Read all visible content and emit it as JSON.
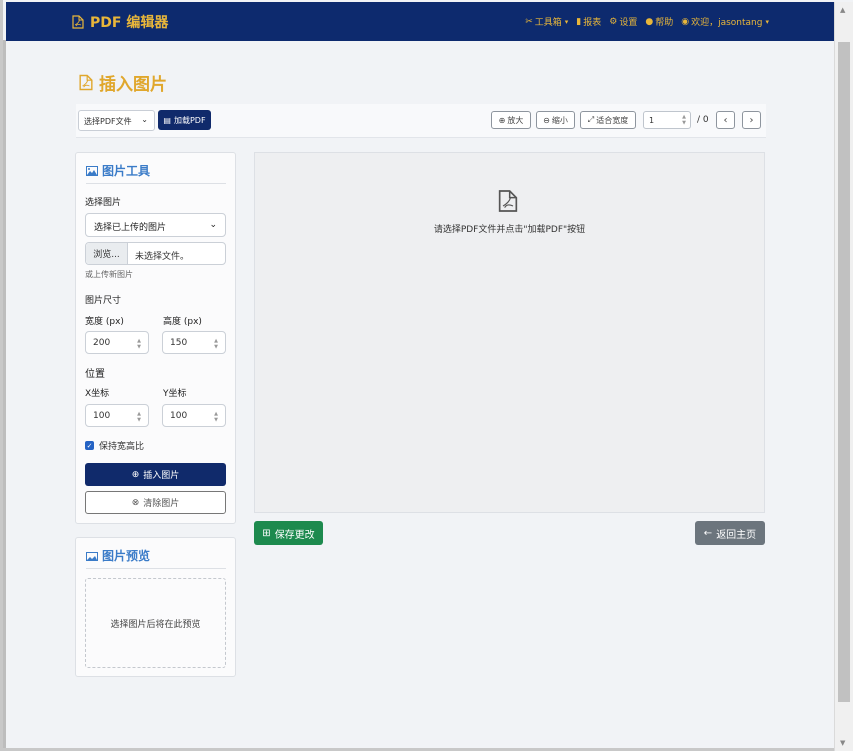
{
  "navbar": {
    "brand": "PDF 编辑器",
    "items": [
      {
        "label": "工具箱",
        "has_caret": true
      },
      {
        "label": "报表"
      },
      {
        "label": "设置"
      },
      {
        "label": "帮助"
      },
      {
        "label": "欢迎，jasontang",
        "has_caret": true
      }
    ]
  },
  "page": {
    "title": "插入图片"
  },
  "toolbar": {
    "pdf_select": "选择PDF文件",
    "load_button": "加载PDF",
    "zoom_in": "放大",
    "zoom_out": "缩小",
    "fit_width": "适合宽度",
    "page_number": "1",
    "page_total": "/ 0",
    "prev": "‹",
    "next": "›"
  },
  "image_tools": {
    "title": "图片工具",
    "select_label": "选择图片",
    "select_value": "选择已上传的图片",
    "browse_button": "浏览...",
    "no_file": "未选择文件。",
    "upload_hint": "或上传新图片",
    "size_label": "图片尺寸",
    "width_label": "宽度 (px)",
    "width_value": "200",
    "height_label": "高度 (px)",
    "height_value": "150",
    "position_label": "位置",
    "x_label": "X坐标",
    "x_value": "100",
    "y_label": "Y坐标",
    "y_value": "100",
    "keep_ratio_label": "保持宽高比",
    "keep_ratio_checked": true,
    "insert_button": "插入图片",
    "clear_button": "清除图片"
  },
  "preview": {
    "title": "图片预览",
    "placeholder": "选择图片后将在此预览"
  },
  "viewer": {
    "message": "请选择PDF文件并点击\"加载PDF\"按钮"
  },
  "actions": {
    "save": "保存更改",
    "back": "返回主页"
  },
  "colors": {
    "navbar_bg": "#0d2a6e",
    "accent": "#e8b63a",
    "primary": "#102a6b",
    "success": "#1d8a4e",
    "secondary": "#6c757d",
    "panel_title": "#3a7bc8"
  }
}
